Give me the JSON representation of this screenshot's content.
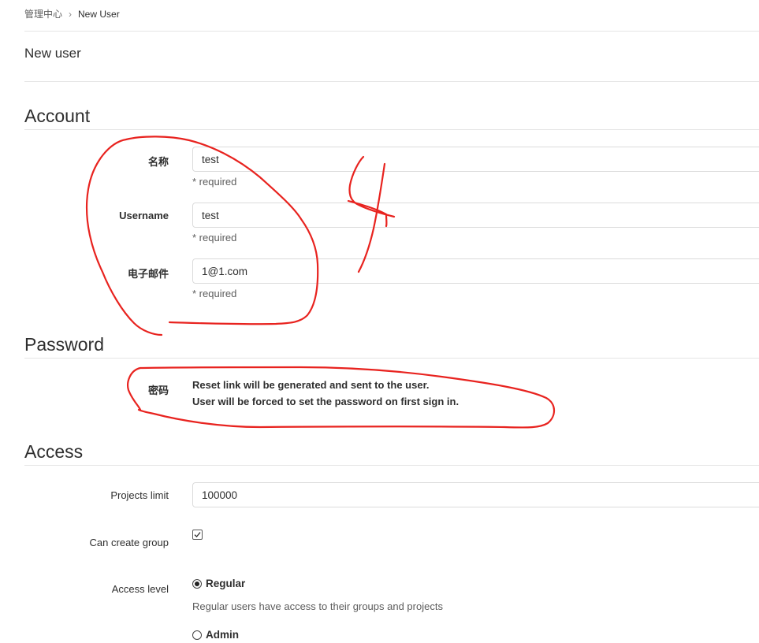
{
  "breadcrumb": {
    "parent": "管理中心",
    "separator": "›",
    "current": "New User"
  },
  "page_title": "New user",
  "sections": {
    "account": "Account",
    "password": "Password",
    "access": "Access"
  },
  "account": {
    "name_label": "名称",
    "name_value": "test",
    "name_help": "* required",
    "username_label": "Username",
    "username_value": "test",
    "username_help": "* required",
    "email_label": "电子邮件",
    "email_value": "1@1.com",
    "email_help": "* required"
  },
  "password": {
    "label": "密码",
    "note_line1": "Reset link will be generated and sent to the user.",
    "note_line2": "User will be forced to set the password on first sign in."
  },
  "access": {
    "projects_limit_label": "Projects limit",
    "projects_limit_value": "100000",
    "can_create_group_label": "Can create group",
    "can_create_group_checked": true,
    "access_level_label": "Access level",
    "regular_label": "Regular",
    "regular_help": "Regular users have access to their groups and projects",
    "admin_label": "Admin",
    "selected_level": "Regular"
  },
  "annotations": {
    "color": "#e8231f"
  }
}
